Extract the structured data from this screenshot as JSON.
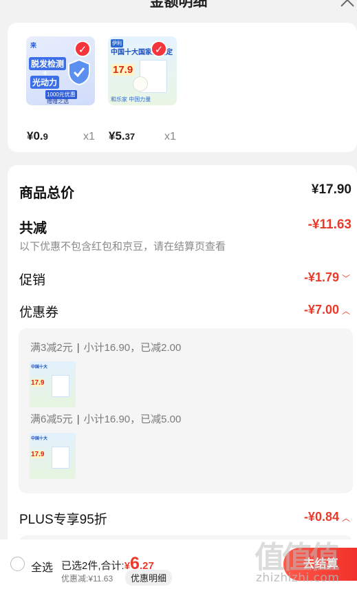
{
  "header": {
    "title": "金额明细",
    "close_icon": "close-icon"
  },
  "products": [
    {
      "price_int": "¥0.",
      "price_dec": "9",
      "qty": "x1",
      "thumb_text": [
        "脱发检测",
        "+",
        "光动力"
      ],
      "thumb_caption": "1000元优惠",
      "thumb_caption2": "赠赠之选",
      "badge": "✓"
    },
    {
      "price_int": "¥5.",
      "price_dec": "37",
      "qty": "x1",
      "thumb_text": [
        "中国十大国家队指定"
      ],
      "thumb_caption": "和乐家 中国力量",
      "thumb_price": "17.9",
      "badge": "✓"
    }
  ],
  "summary": {
    "goods_total_label": "商品总价",
    "goods_total_value": "¥17.90",
    "total_reduce_label": "共减",
    "total_reduce_value": "-¥11.63",
    "note": "以下优惠不包含红包和京豆，请在结算页查看",
    "promo_label": "促销",
    "promo_value": "-¥1.79",
    "coupon_label": "优惠券",
    "coupon_value": "-¥7.00",
    "plus_label": "PLUS专享95折",
    "plus_value": "-¥0.84"
  },
  "coupons": [
    {
      "rule": "满3减2元",
      "detail": "小计16.90，已减2.00"
    },
    {
      "rule": "满6减5元",
      "detail": "小计16.90，已减5.00"
    }
  ],
  "bottom": {
    "select_all": "全选",
    "selected_prefix": "已选2件,合计:",
    "total_currency": "¥",
    "total_int": "6",
    "total_dec": ".27",
    "discount": "优惠减:¥11.63",
    "detail_pill": "优惠明细",
    "checkout": "去结算"
  },
  "watermark": {
    "text": "zhizhizhi.com",
    "glyphs": "值值值"
  },
  "colors": {
    "accent": "#e93a2a",
    "background": "#f2f2f2"
  }
}
